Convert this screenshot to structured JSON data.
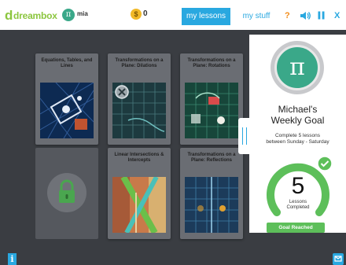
{
  "header": {
    "logo_text": "dreambox",
    "username": "mia",
    "coin_symbol": "$",
    "coins": "0",
    "tabs": [
      {
        "label": "my lessons",
        "active": true
      },
      {
        "label": "my stuff",
        "active": false
      }
    ],
    "help_label": "?",
    "close_label": "X"
  },
  "lessons": [
    {
      "title": "Equations, Tables, and Lines",
      "locked": false
    },
    {
      "title": "Transformations on a Plane: Dilations",
      "locked": false
    },
    {
      "title": "Transformations on a Plane: Rotations",
      "locked": false
    },
    {
      "title": "",
      "locked": true
    },
    {
      "title": "Linear Intersections & Intercepts",
      "locked": false
    },
    {
      "title": "Transformations on a Plane: Reflections",
      "locked": false
    }
  ],
  "goal_panel": {
    "badge_symbol": "π",
    "title_line1": "Michael's",
    "title_line2": "Weekly Goal",
    "subtitle_line1": "Complete 5 lessons",
    "subtitle_line2": "between Sunday - Saturday",
    "lessons_completed": "5",
    "completed_label_line1": "Lessons",
    "completed_label_line2": "Completed",
    "progress_fraction": 1.0,
    "status_button": "Goal Reached"
  },
  "footer": {
    "info_label": "i"
  },
  "colors": {
    "accent_blue": "#29a8e0",
    "brand_green": "#8cc63f",
    "teal": "#3aa889",
    "gauge_green": "#5dbf5a",
    "coin_gold": "#f2b928",
    "help_orange": "#f28c1a"
  }
}
